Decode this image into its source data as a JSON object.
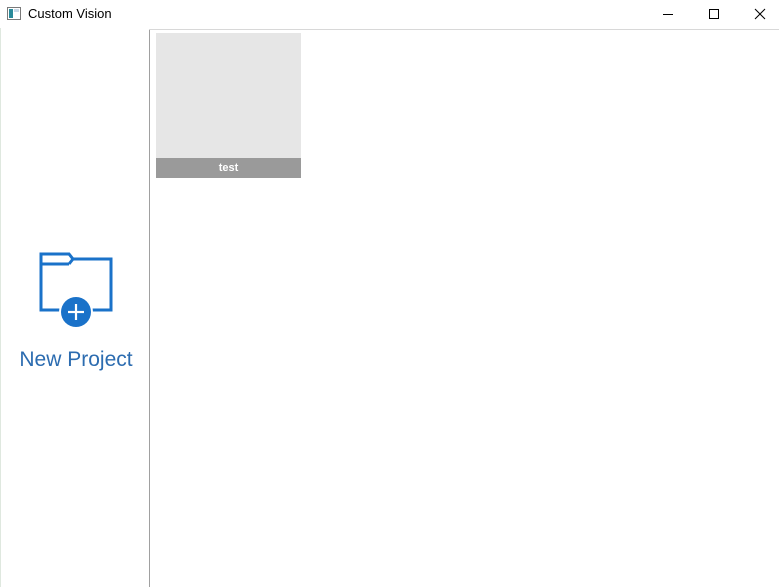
{
  "window": {
    "title": "Custom Vision",
    "controls": {
      "minimize_icon": "minimize-icon",
      "maximize_icon": "maximize-icon",
      "close_icon": "close-icon"
    }
  },
  "sidebar": {
    "new_project_label": "New Project",
    "new_project_icon": "folder-add-icon"
  },
  "projects": [
    {
      "name": "test"
    }
  ],
  "colors": {
    "accent": "#2c6cb0",
    "icon_blue": "#1a72c9",
    "tile_bg": "#e6e6e6",
    "tile_caption_bg": "#9a9a9a"
  }
}
